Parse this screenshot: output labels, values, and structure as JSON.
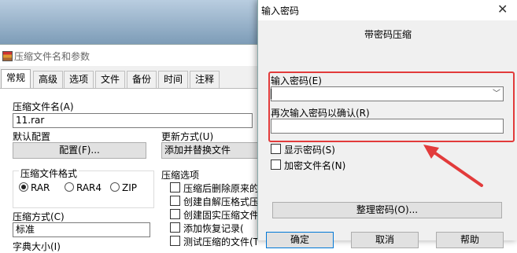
{
  "back_window": {
    "title": "压缩文件名和参数",
    "tabs": [
      "常规",
      "高级",
      "选项",
      "文件",
      "备份",
      "时间",
      "注释"
    ],
    "archive_name_label": "压缩文件名(A)",
    "archive_name_value": "11.rar",
    "default_config_label": "默认配置",
    "config_button": "配置(F)...",
    "update_mode_label": "更新方式(U)",
    "update_mode_value": "添加并替换文件",
    "format_label": "压缩文件格式",
    "formats": [
      "RAR",
      "RAR4",
      "ZIP"
    ],
    "selected_format": "RAR",
    "options_label": "压缩选项",
    "options": [
      "压缩后删除原来的文",
      "创建自解压格式压缩",
      "创建固实压缩文件(",
      "添加恢复记录(",
      "测试压缩的文件(T"
    ],
    "method_label": "压缩方式(C)",
    "method_value": "标准",
    "dict_label": "字典大小(I)"
  },
  "dialog": {
    "title": "输入密码",
    "heading": "带密码压缩",
    "password_label": "输入密码(E)",
    "password_value": "",
    "confirm_label": "再次输入密码以确认(R)",
    "confirm_value": "",
    "show_password": "显示密码(S)",
    "encrypt_names": "加密文件名(N)",
    "organize_button": "整理密码(O)...",
    "ok_button": "确定",
    "cancel_button": "取消",
    "help_button": "帮助"
  },
  "colors": {
    "annotation_red": "#e23b3b"
  }
}
